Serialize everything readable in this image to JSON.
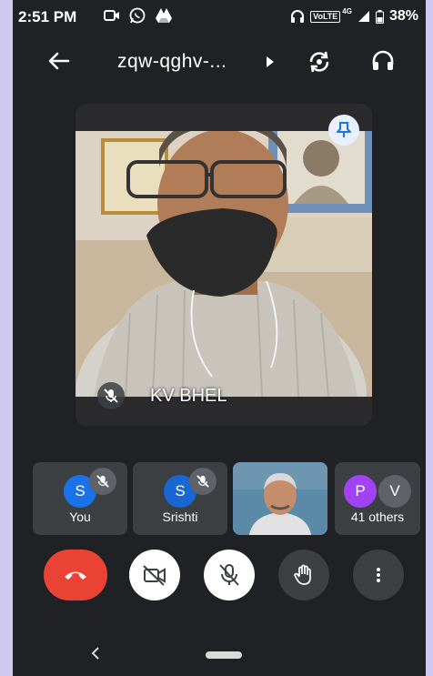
{
  "status_bar": {
    "time": "2:51 PM",
    "volte": "VoLTE",
    "network": "4G",
    "battery": "38%"
  },
  "header": {
    "meeting_code": "zqw-qghv-..."
  },
  "main_tile": {
    "name": "KV BHEL"
  },
  "participants": [
    {
      "initial": "S",
      "label": "You",
      "avatar_color": "#1a73e8",
      "muted": true
    },
    {
      "initial": "S",
      "label": "Srishti",
      "avatar_color": "#1967d2",
      "muted": true
    },
    {
      "initial": "",
      "label": "",
      "video": true
    },
    {
      "initials": [
        "P",
        "V"
      ],
      "label": "41 others",
      "avatar_colors": [
        "#a142f4",
        "#5f6368"
      ]
    }
  ],
  "controls": [
    "end-call",
    "camera-off",
    "mic-off",
    "raise-hand",
    "more-options"
  ],
  "colors": {
    "background": "#202124",
    "end_call": "#ea4335",
    "tile": "#3c4043",
    "outer": "#cfc9ef"
  }
}
